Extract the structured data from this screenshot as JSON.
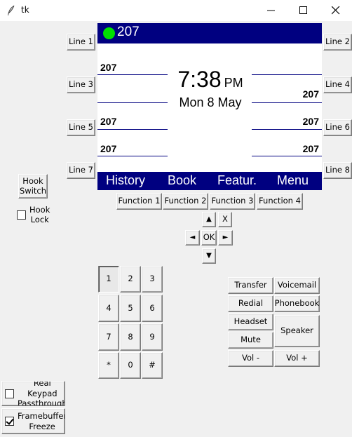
{
  "window": {
    "title": "tk"
  },
  "screen": {
    "top_number": "207",
    "status_color": "#00e000",
    "left_lines": [
      "207",
      "",
      "207",
      "207"
    ],
    "right_lines": [
      "",
      "207",
      "207",
      "207"
    ],
    "time": "7:38",
    "ampm": "PM",
    "date": "Mon 8 May",
    "softkeys": [
      "History",
      "Book",
      "Featur.",
      "Menu"
    ]
  },
  "line_buttons": {
    "left": [
      "Line 1",
      "Line 3",
      "Line 5",
      "Line 7"
    ],
    "right": [
      "Line 2",
      "Line 4",
      "Line 6",
      "Line 8"
    ]
  },
  "function_buttons": [
    "Function 1",
    "Function 2",
    "Function 3",
    "Function 4"
  ],
  "nav": {
    "up": "▲",
    "down": "▼",
    "left": "◄",
    "right": "►",
    "ok": "OK",
    "cancel": "X"
  },
  "keypad": [
    "1",
    "2",
    "3",
    "4",
    "5",
    "6",
    "7",
    "8",
    "9",
    "*",
    "0",
    "#"
  ],
  "actions": {
    "transfer": "Transfer",
    "voicemail": "Voicemail",
    "redial": "Redial",
    "phonebook": "Phonebook",
    "headset": "Headset",
    "speaker": "Speaker",
    "mute": "Mute",
    "vol_down": "Vol -",
    "vol_up": "Vol +"
  },
  "hook": {
    "switch_label": "Hook\nSwitch",
    "lock_label": "Hook\nLock",
    "lock_checked": false
  },
  "options": {
    "keypad_passthrough": "Real Keypad\nPassthrough",
    "keypad_passthrough_checked": false,
    "framebuffer_freeze": "Framebuffer\nFreeze",
    "framebuffer_freeze_checked": true
  },
  "colors": {
    "screen_bar": "#000080",
    "window_bg": "#f0f0f0"
  }
}
